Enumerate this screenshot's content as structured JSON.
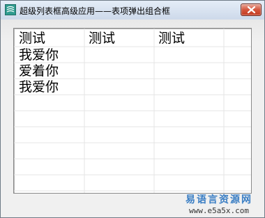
{
  "window": {
    "title": "超级列表框高级应用——表项弹出组合框"
  },
  "icons": {
    "app": "app-icon",
    "close": "close-icon"
  },
  "list": {
    "headers": [
      "测试",
      "测试",
      "测试"
    ],
    "rows": [
      [
        "我爱你",
        "",
        ""
      ],
      [
        "爱着你",
        "",
        ""
      ],
      [
        "我爱你",
        "",
        ""
      ]
    ]
  },
  "watermark": {
    "site_name": "易语言资源网",
    "url": "www.e5a5x.com"
  },
  "colors": {
    "title_bar_top": "#e4edf7",
    "title_bar_bottom": "#cdd9ea",
    "close_button": "#c23b22",
    "grid_line": "#e4e4e4",
    "watermark_text": "#3a7ec4"
  }
}
